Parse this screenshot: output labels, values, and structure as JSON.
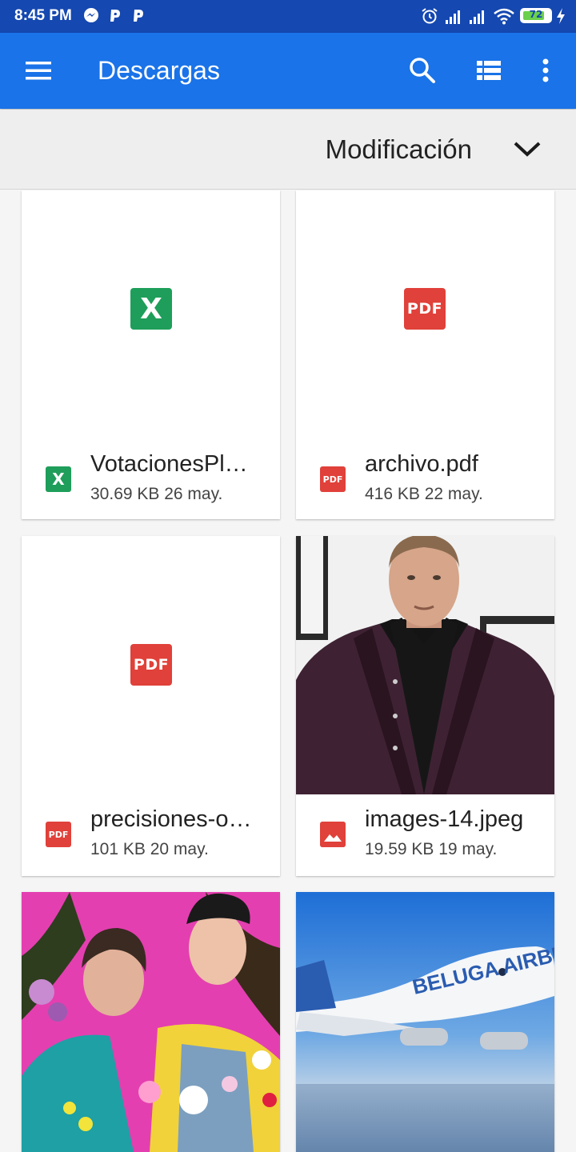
{
  "status_bar": {
    "time": "8:45 PM",
    "battery": "72",
    "notification_icons": [
      "messenger-icon",
      "p-app-icon",
      "p-app-icon"
    ],
    "system_icons": [
      "alarm-icon",
      "signal-icon",
      "signal-icon",
      "wifi-icon",
      "battery-icon",
      "charging-icon"
    ]
  },
  "app_bar": {
    "title": "Descargas",
    "icons": [
      "menu-icon",
      "search-icon",
      "list-view-icon",
      "more-vert-icon"
    ],
    "color": "#1a73e8"
  },
  "sort": {
    "label": "Modificación",
    "icon": "chevron-down-icon"
  },
  "files": [
    {
      "name": "VotacionesPl…",
      "info": "30.69 KB 26 may.",
      "type": "xls",
      "badge": "X",
      "icon": "spreadsheet-icon"
    },
    {
      "name": "archivo.pdf",
      "info": "416 KB 22 may.",
      "type": "pdf",
      "badge": "PDF",
      "icon": "pdf-icon"
    },
    {
      "name": "precisiones-o…",
      "info": "101 KB 20 may.",
      "type": "pdf",
      "badge": "PDF",
      "icon": "pdf-icon"
    },
    {
      "name": "images-14.jpeg",
      "info": "19.59 KB 19 may.",
      "type": "img",
      "icon": "image-icon",
      "thumbnail": "man-in-suit-photo"
    },
    {
      "type": "img",
      "thumbnail": "two-men-with-flowers-photo"
    },
    {
      "type": "img",
      "thumbnail": "airbus-beluga-airplane-photo",
      "thumbnail_text": "BELUGA AIRBUS"
    }
  ],
  "colors": {
    "status_bar": "#1548b0",
    "excel_green": "#1e9e5a",
    "pdf_red": "#e0413a"
  }
}
